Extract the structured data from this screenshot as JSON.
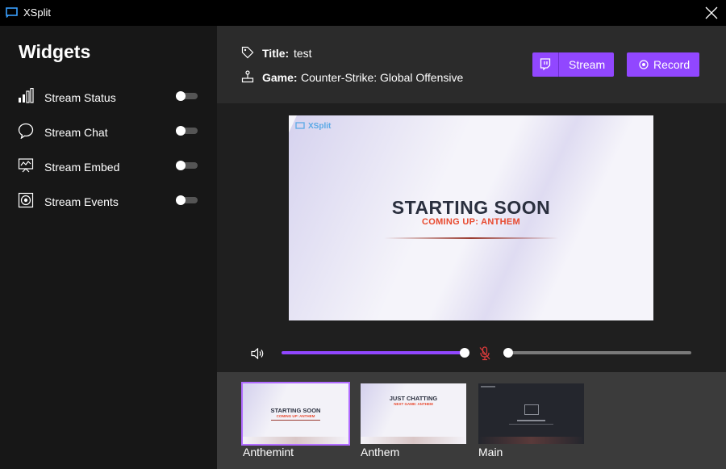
{
  "app": {
    "title": "XSplit"
  },
  "sidebar": {
    "heading": "Widgets",
    "items": [
      {
        "label": "Stream Status",
        "icon": "signal-bars-icon",
        "enabled": false
      },
      {
        "label": "Stream Chat",
        "icon": "chat-bubble-icon",
        "enabled": false
      },
      {
        "label": "Stream Embed",
        "icon": "presentation-chart-icon",
        "enabled": false
      },
      {
        "label": "Stream Events",
        "icon": "target-icon",
        "enabled": false
      }
    ]
  },
  "header": {
    "title_label": "Title:",
    "title_value": "test",
    "game_label": "Game:",
    "game_value": "Counter-Strike: Global Offensive",
    "stream_button": "Stream",
    "record_button": "Record"
  },
  "preview": {
    "brand": "XSplit",
    "title": "STARTING SOON",
    "subtitle": "COMING UP: ANTHEM"
  },
  "audio": {
    "speaker_level": 1.0,
    "mic_level": 0.0,
    "mic_muted": true
  },
  "scenes": [
    {
      "label": "Anthemint",
      "active": true,
      "thumb_title": "STARTING SOON",
      "thumb_subtitle": "COMING UP: ANTHEM"
    },
    {
      "label": "Anthem",
      "active": false,
      "thumb_title": "JUST CHATTING",
      "thumb_subtitle": "NEXT GAME: ANTHEM"
    },
    {
      "label": "Main",
      "active": false
    }
  ],
  "colors": {
    "accent": "#9147ff",
    "muted_mic": "#e03b3b",
    "subtitle": "#e8492e"
  }
}
